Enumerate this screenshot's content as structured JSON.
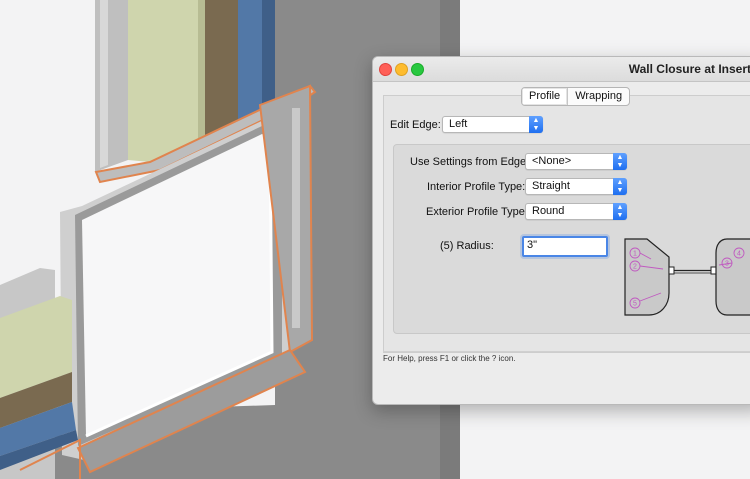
{
  "window": {
    "title": "Wall Closure at Insert"
  },
  "tabs": [
    {
      "label": "Profile",
      "active": true
    },
    {
      "label": "Wrapping",
      "active": false
    }
  ],
  "edit_edge": {
    "label": "Edit Edge:",
    "value": "Left"
  },
  "settings": {
    "use_settings_label": "Use Settings from Edge:",
    "use_settings_value": "<None>",
    "interior_label": "Interior Profile Type:",
    "interior_value": "Straight",
    "exterior_label": "Exterior Profile Type:",
    "exterior_value": "Round",
    "radius_label": "(5) Radius:",
    "radius_value": "3\""
  },
  "diagram": {
    "callouts": [
      "1",
      "2",
      "3",
      "4",
      "5"
    ],
    "accent_color": "#c05ac0"
  },
  "status": {
    "help_text": "For Help, press F1 or click the ? icon."
  },
  "colors": {
    "closure_outline": "#e0844e",
    "accent_blue": "#2f74f0",
    "insulation_green": "#d2d8b0",
    "wall_blue": "#4f77a8"
  }
}
